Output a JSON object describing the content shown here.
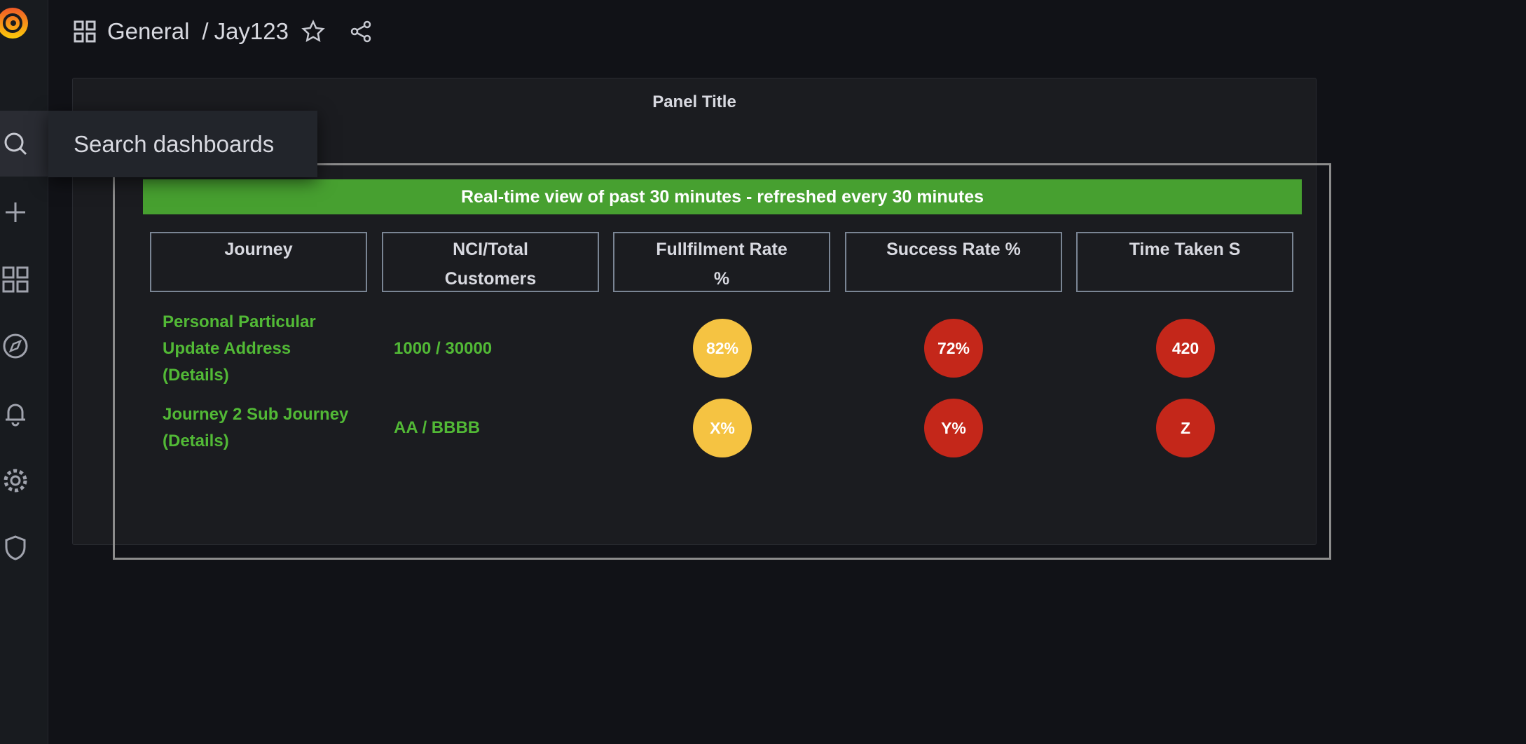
{
  "breadcrumb": {
    "folder": "General",
    "dashboard": "Jay123"
  },
  "sidebar": {
    "icons": [
      "search-icon",
      "plus-icon",
      "dashboards-icon",
      "explore-icon",
      "alerting-icon",
      "gear-icon",
      "shield-icon"
    ]
  },
  "tooltip": "Search dashboards",
  "panel": {
    "title": "Panel Title",
    "banner": "Real-time view of past 30 minutes - refreshed every 30 minutes",
    "headers": [
      [
        "Journey",
        ""
      ],
      [
        "NCI/Total",
        "Customers"
      ],
      [
        "Fullfilment Rate",
        "%"
      ],
      [
        "Success Rate %",
        ""
      ],
      [
        "Time Taken S",
        ""
      ]
    ],
    "rows": [
      {
        "journey": [
          "Personal Particular",
          "Update Address",
          "(Details)"
        ],
        "nci": "1000 / 30000",
        "fulfilment": "82%",
        "success": "72%",
        "time": "420"
      },
      {
        "journey": [
          "Journey 2 Sub Journey",
          "(Details)"
        ],
        "nci": "AA / BBBB",
        "fulfilment": "X%",
        "success": "Y%",
        "time": "Z"
      }
    ]
  },
  "colors": {
    "banner": "#47a030",
    "text_green": "#52b936",
    "yellow": "#f5c342",
    "red": "#c4271a"
  }
}
